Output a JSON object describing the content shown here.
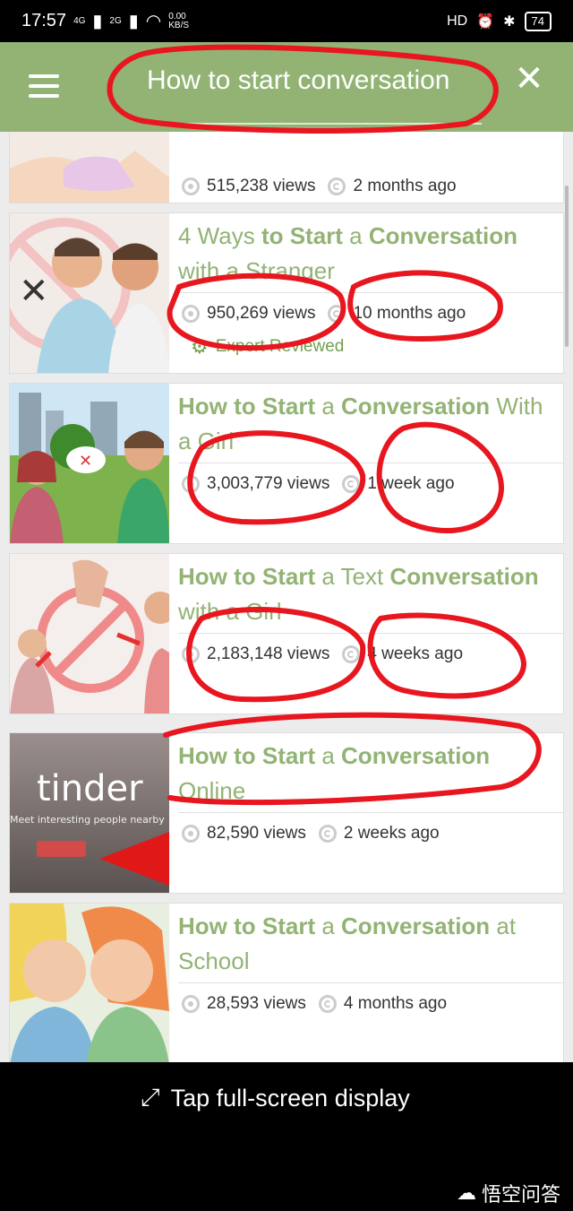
{
  "status_bar": {
    "time": "17:57",
    "net1": "4G",
    "net2": "2G",
    "speed_value": "0.00",
    "speed_unit": "KB/S",
    "hd": "HD",
    "battery": "74"
  },
  "app_bar": {
    "search_text": "How to start conversation"
  },
  "articles": [
    {
      "title_parts": [],
      "views": "515,238 views",
      "age": "2 months ago",
      "expert": ""
    },
    {
      "title_parts": [
        {
          "text": "4 Ways ",
          "bold": false
        },
        {
          "text": "to Start",
          "bold": true
        },
        {
          "text": " a ",
          "bold": false
        },
        {
          "text": "Conversation",
          "bold": true
        },
        {
          "text": " with a Stranger",
          "bold": false
        }
      ],
      "views": "950,269 views",
      "age": "10 months ago",
      "expert": "Expert Reviewed"
    },
    {
      "title_parts": [
        {
          "text": "How to Start",
          "bold": true
        },
        {
          "text": " a ",
          "bold": false
        },
        {
          "text": "Conversation",
          "bold": true
        },
        {
          "text": " With a Girl",
          "bold": false
        }
      ],
      "views": "3,003,779 views",
      "age": "1 week ago",
      "expert": ""
    },
    {
      "title_parts": [
        {
          "text": "How to Start",
          "bold": true
        },
        {
          "text": " a Text ",
          "bold": false
        },
        {
          "text": "Conversation",
          "bold": true
        },
        {
          "text": " with a Girl",
          "bold": false
        }
      ],
      "views": "2,183,148 views",
      "age": "4 weeks ago",
      "expert": ""
    },
    {
      "title_parts": [
        {
          "text": "How to Start",
          "bold": true
        },
        {
          "text": " a ",
          "bold": false
        },
        {
          "text": "Conversation",
          "bold": true
        },
        {
          "text": " Online",
          "bold": false
        }
      ],
      "views": "82,590 views",
      "age": "2 weeks ago",
      "expert": "",
      "thumb_text": "tinder",
      "thumb_sub": "Meet interesting people nearby"
    },
    {
      "title_parts": [
        {
          "text": "How to Start",
          "bold": true
        },
        {
          "text": " a ",
          "bold": false
        },
        {
          "text": "Conversation",
          "bold": true
        },
        {
          "text": " at School",
          "bold": false
        }
      ],
      "views": "28,593 views",
      "age": "4 months ago",
      "expert": ""
    }
  ],
  "bottom": {
    "fullscreen_label": "Tap full-screen display",
    "watermark": "悟空问答"
  },
  "colors": {
    "accent": "#92b374",
    "annotation": "#e8161e"
  }
}
